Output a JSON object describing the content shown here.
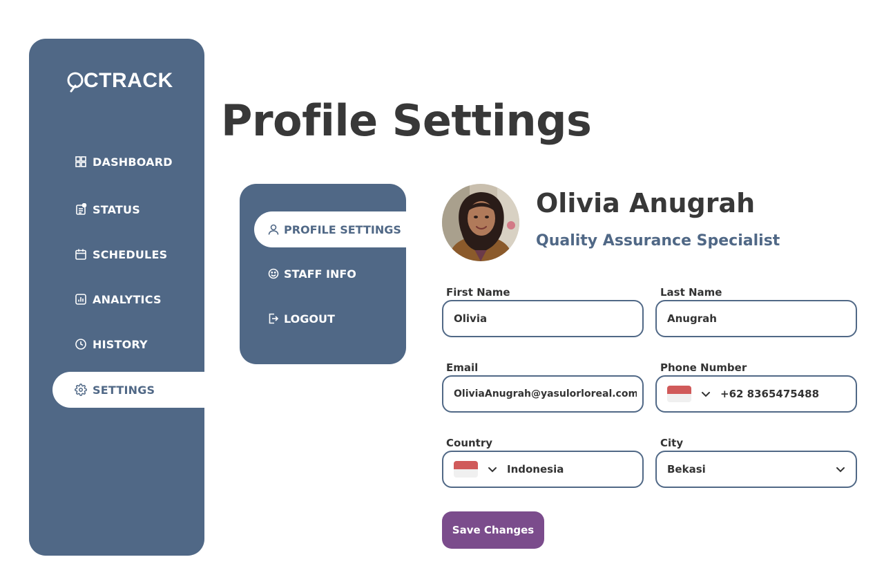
{
  "app": {
    "logo_text": "CTRACK"
  },
  "sidebar": {
    "items": [
      {
        "label": "DASHBOARD",
        "icon": "dashboard-grid-icon"
      },
      {
        "label": "STATUS",
        "icon": "status-document-icon"
      },
      {
        "label": "SCHEDULES",
        "icon": "calendar-icon"
      },
      {
        "label": "ANALYTICS",
        "icon": "bar-chart-icon"
      },
      {
        "label": "HISTORY",
        "icon": "clock-icon"
      },
      {
        "label": "SETTINGS",
        "icon": "gear-icon",
        "active": true
      }
    ]
  },
  "page": {
    "title": "Profile Settings"
  },
  "subnav": {
    "items": [
      {
        "label": "PROFILE SETTINGS",
        "icon": "user-icon",
        "active": true
      },
      {
        "label": "STAFF INFO",
        "icon": "smiley-icon"
      },
      {
        "label": "LOGOUT",
        "icon": "logout-icon"
      }
    ]
  },
  "profile": {
    "name": "Olivia Anugrah",
    "role": "Quality Assurance Specialist"
  },
  "form": {
    "first_name": {
      "label": "First Name",
      "value": "Olivia"
    },
    "last_name": {
      "label": "Last Name",
      "value": "Anugrah"
    },
    "email": {
      "label": "Email",
      "value": "OliviaAnugrah@yasulorloreal.com"
    },
    "phone": {
      "label": "Phone Number",
      "value": "+62 8365475488",
      "flag": "indonesia-flag-icon"
    },
    "country": {
      "label": "Country",
      "value": "Indonesia",
      "flag": "indonesia-flag-icon"
    },
    "city": {
      "label": "City",
      "value": "Bekasi"
    },
    "save_label": "Save Changes"
  },
  "colors": {
    "primary": "#506886",
    "accent": "#7b4c8c",
    "text": "#383838",
    "flag_red": "#d05a5a"
  }
}
